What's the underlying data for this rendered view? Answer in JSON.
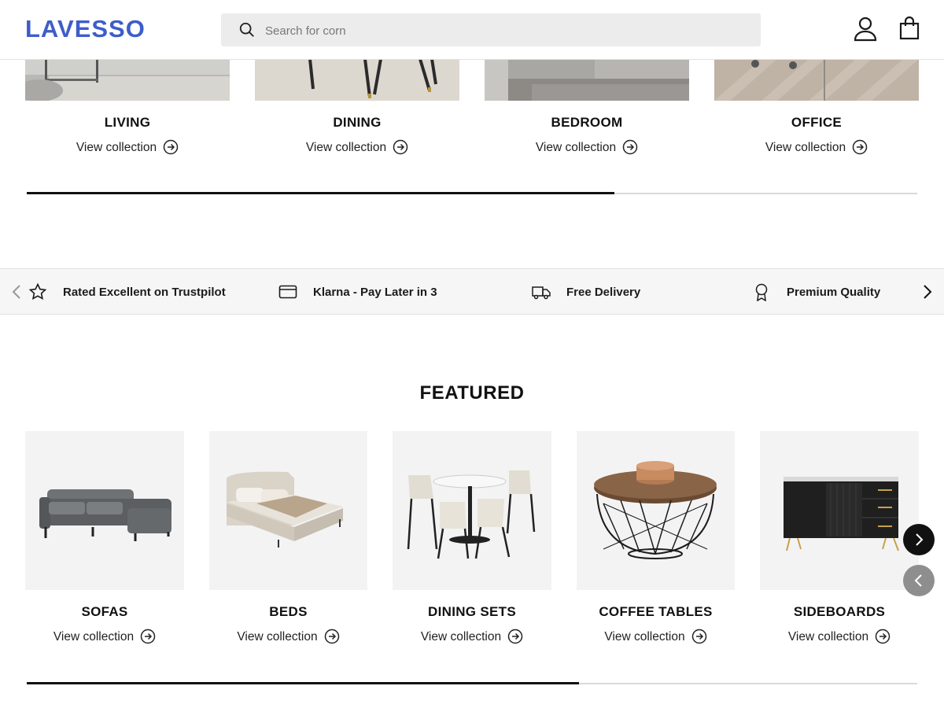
{
  "header": {
    "logo": "LAVESSO",
    "search_placeholder": "Search for corn",
    "brand_color": "#3d5ec9",
    "icons": [
      "search-icon",
      "account-icon",
      "bag-icon"
    ]
  },
  "rooms": {
    "link_label": "View collection",
    "items": [
      {
        "name": "LIVING"
      },
      {
        "name": "DINING"
      },
      {
        "name": "BEDROOM"
      },
      {
        "name": "OFFICE"
      }
    ],
    "scroll_progress": 0.66
  },
  "usp_bar": {
    "items": [
      {
        "icon": "star-icon",
        "label": "Rated Excellent on Trustpilot"
      },
      {
        "icon": "card-icon",
        "label": "Klarna - Pay Later in 3"
      },
      {
        "icon": "truck-icon",
        "label": "Free Delivery"
      },
      {
        "icon": "award-icon",
        "label": "Premium Quality"
      }
    ]
  },
  "featured": {
    "title": "FEATURED",
    "link_label": "View collection",
    "items": [
      {
        "name": "SOFAS"
      },
      {
        "name": "BEDS"
      },
      {
        "name": "DINING SETS"
      },
      {
        "name": "COFFEE TABLES"
      },
      {
        "name": "SIDEBOARDS"
      }
    ],
    "scroll_progress": 0.62
  }
}
